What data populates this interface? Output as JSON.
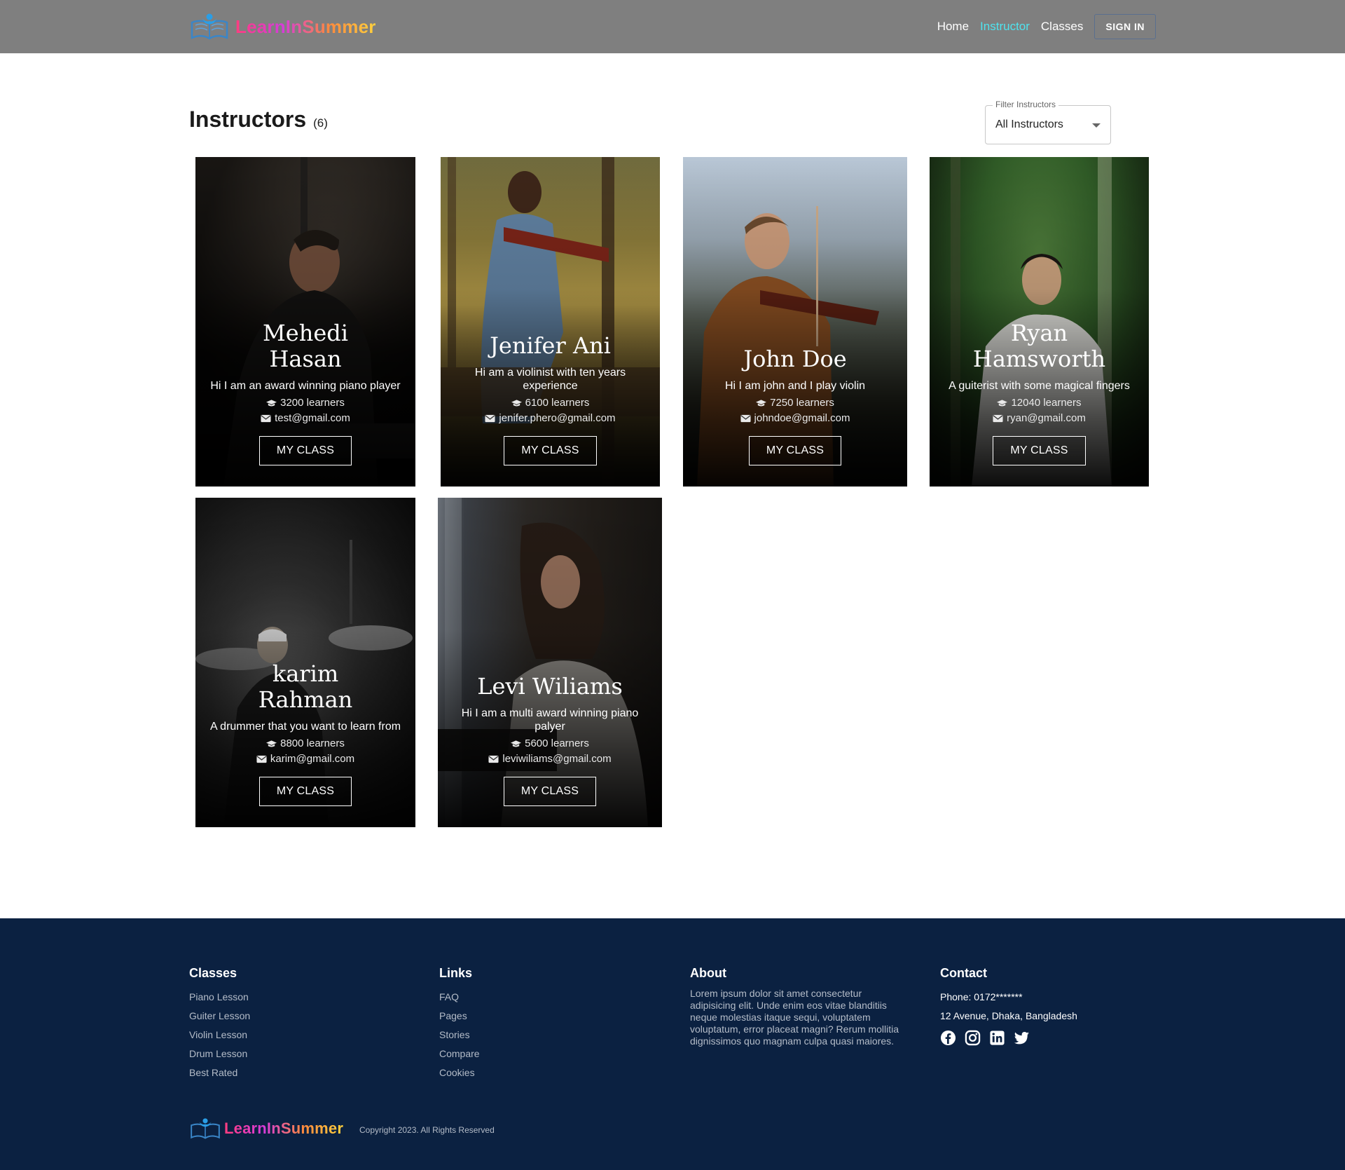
{
  "nav": {
    "brand": "LearnInSummer",
    "links": [
      "Home",
      "Instructor",
      "Classes"
    ],
    "sign_in": "SIGN IN"
  },
  "page": {
    "title": "Instructors",
    "count": "(6)"
  },
  "filter": {
    "label": "Filter Instructors",
    "value": "All Instructors"
  },
  "instructors": [
    {
      "name": "Mehedi Hasan",
      "bio": "Hi I am an award winning piano player",
      "learners": "3200 learners",
      "email": "test@gmail.com",
      "button": "MY CLASS"
    },
    {
      "name": "Jenifer Ani",
      "bio": "Hi am a violinist with ten years experience",
      "learners": "6100 learners",
      "email": "jenifer.phero@gmail.com",
      "button": "MY CLASS"
    },
    {
      "name": "John Doe",
      "bio": "Hi I am john and I play violin",
      "learners": "7250 learners",
      "email": "johndoe@gmail.com",
      "button": "MY CLASS"
    },
    {
      "name": "Ryan Hamsworth",
      "bio": "A guiterist with some magical fingers",
      "learners": "12040 learners",
      "email": "ryan@gmail.com",
      "button": "MY CLASS"
    },
    {
      "name": "karim Rahman",
      "bio": "A drummer that you want to learn from",
      "learners": "8800 learners",
      "email": "karim@gmail.com",
      "button": "MY CLASS"
    },
    {
      "name": "Levi Wiliams",
      "bio": "Hi I am a multi award winning piano palyer",
      "learners": "5600 learners",
      "email": "leviwiliams@gmail.com",
      "button": "MY CLASS"
    }
  ],
  "footer": {
    "classes": {
      "title": "Classes",
      "items": [
        "Piano Lesson",
        "Guiter Lesson",
        "Violin Lesson",
        "Drum Lesson",
        "Best Rated"
      ]
    },
    "links": {
      "title": "Links",
      "items": [
        "FAQ",
        "Pages",
        "Stories",
        "Compare",
        "Cookies"
      ]
    },
    "about": {
      "title": "About",
      "text": "Lorem ipsum dolor sit amet consectetur adipisicing elit. Unde enim eos vitae blanditiis neque molestias itaque sequi, voluptatem voluptatum, error placeat magni? Rerum mollitia dignissimos quo magnam culpa quasi maiores."
    },
    "contact": {
      "title": "Contact",
      "phone": "Phone: 0172*******",
      "address": "12 Avenue, Dhaka, Bangladesh",
      "socials": [
        "facebook-icon",
        "instagram-icon",
        "linkedin-icon",
        "twitter-icon"
      ]
    },
    "brand": "LearnInSummer",
    "copyright": "Copyright 2023. All Rights Reserved"
  },
  "colors": {
    "navbar": "#7f7f7f",
    "active_link": "#4fe3ee",
    "footer": "#0b2141"
  }
}
